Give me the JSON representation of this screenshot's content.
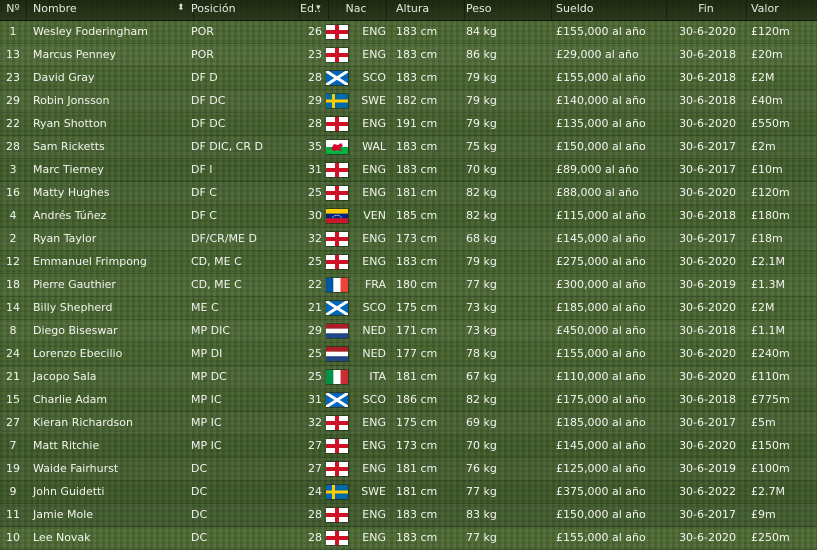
{
  "headers": {
    "no": "Nº",
    "name": "Nombre",
    "position": "Posición",
    "age": "Ed..",
    "nationality": "Nac",
    "height": "Altura",
    "weight": "Peso",
    "wage": "Sueldo",
    "contract_end": "Fin",
    "value": "Valor"
  },
  "sort_indicator_icon": "sort-updown-icon",
  "players": [
    {
      "no": "1",
      "name": "Wesley Foderingham",
      "position": "POR",
      "age": "26",
      "flag": "ENG",
      "nat": "ENG",
      "height": "183 cm",
      "weight": "84 kg",
      "wage": "£155,000 al año",
      "end": "30-6-2020",
      "value": "£120m"
    },
    {
      "no": "13",
      "name": "Marcus Penney",
      "position": "POR",
      "age": "23",
      "flag": "ENG",
      "nat": "ENG",
      "height": "183 cm",
      "weight": "86 kg",
      "wage": "£29,000 al año",
      "end": "30-6-2018",
      "value": "£20m"
    },
    {
      "no": "23",
      "name": "David Gray",
      "position": "DF D",
      "age": "28",
      "flag": "SCO",
      "nat": "SCO",
      "height": "183 cm",
      "weight": "79 kg",
      "wage": "£155,000 al año",
      "end": "30-6-2018",
      "value": "£2M"
    },
    {
      "no": "29",
      "name": "Robin Jonsson",
      "position": "DF DC",
      "age": "29",
      "flag": "SWE",
      "nat": "SWE",
      "height": "182 cm",
      "weight": "79 kg",
      "wage": "£140,000 al año",
      "end": "30-6-2018",
      "value": "£40m"
    },
    {
      "no": "22",
      "name": "Ryan Shotton",
      "position": "DF DC",
      "age": "28",
      "flag": "ENG",
      "nat": "ENG",
      "height": "191 cm",
      "weight": "79 kg",
      "wage": "£135,000 al año",
      "end": "30-6-2020",
      "value": "£550m"
    },
    {
      "no": "28",
      "name": "Sam Ricketts",
      "position": "DF DIC, CR D",
      "age": "35",
      "flag": "WAL",
      "nat": "WAL",
      "height": "183 cm",
      "weight": "75 kg",
      "wage": "£150,000 al año",
      "end": "30-6-2017",
      "value": "£2m"
    },
    {
      "no": "3",
      "name": "Marc Tierney",
      "position": "DF I",
      "age": "31",
      "flag": "ENG",
      "nat": "ENG",
      "height": "183 cm",
      "weight": "70 kg",
      "wage": "£89,000 al año",
      "end": "30-6-2017",
      "value": "£10m"
    },
    {
      "no": "16",
      "name": "Matty Hughes",
      "position": "DF C",
      "age": "25",
      "flag": "ENG",
      "nat": "ENG",
      "height": "181 cm",
      "weight": "82 kg",
      "wage": "£88,000 al año",
      "end": "30-6-2020",
      "value": "£120m"
    },
    {
      "no": "4",
      "name": "Andrés Túñez",
      "position": "DF C",
      "age": "30",
      "flag": "VEN",
      "nat": "VEN",
      "height": "185 cm",
      "weight": "82 kg",
      "wage": "£115,000 al año",
      "end": "30-6-2018",
      "value": "£180m"
    },
    {
      "no": "2",
      "name": "Ryan Taylor",
      "position": "DF/CR/ME D",
      "age": "32",
      "flag": "ENG",
      "nat": "ENG",
      "height": "173 cm",
      "weight": "68 kg",
      "wage": "£145,000 al año",
      "end": "30-6-2017",
      "value": "£18m"
    },
    {
      "no": "12",
      "name": "Emmanuel Frimpong",
      "position": "CD, ME C",
      "age": "25",
      "flag": "ENG",
      "nat": "ENG",
      "height": "183 cm",
      "weight": "79 kg",
      "wage": "£275,000 al año",
      "end": "30-6-2020",
      "value": "£2.1M"
    },
    {
      "no": "18",
      "name": "Pierre Gauthier",
      "position": "CD, ME C",
      "age": "22",
      "flag": "FRA",
      "nat": "FRA",
      "height": "180 cm",
      "weight": "77 kg",
      "wage": "£300,000 al año",
      "end": "30-6-2019",
      "value": "£1.3M"
    },
    {
      "no": "14",
      "name": "Billy Shepherd",
      "position": "ME C",
      "age": "21",
      "flag": "SCO",
      "nat": "SCO",
      "height": "175 cm",
      "weight": "73 kg",
      "wage": "£185,000 al año",
      "end": "30-6-2020",
      "value": "£2M"
    },
    {
      "no": "8",
      "name": "Diego Biseswar",
      "position": "MP DIC",
      "age": "29",
      "flag": "NED",
      "nat": "NED",
      "height": "171 cm",
      "weight": "73 kg",
      "wage": "£450,000 al año",
      "end": "30-6-2018",
      "value": "£1.1M"
    },
    {
      "no": "24",
      "name": "Lorenzo Ebecilio",
      "position": "MP DI",
      "age": "25",
      "flag": "NED",
      "nat": "NED",
      "height": "177 cm",
      "weight": "78 kg",
      "wage": "£155,000 al año",
      "end": "30-6-2020",
      "value": "£240m"
    },
    {
      "no": "21",
      "name": "Jacopo Sala",
      "position": "MP DC",
      "age": "25",
      "flag": "ITA",
      "nat": "ITA",
      "height": "181 cm",
      "weight": "67 kg",
      "wage": "£110,000 al año",
      "end": "30-6-2020",
      "value": "£110m"
    },
    {
      "no": "15",
      "name": "Charlie Adam",
      "position": "MP IC",
      "age": "31",
      "flag": "SCO",
      "nat": "SCO",
      "height": "186 cm",
      "weight": "82 kg",
      "wage": "£175,000 al año",
      "end": "30-6-2018",
      "value": "£775m"
    },
    {
      "no": "27",
      "name": "Kieran Richardson",
      "position": "MP IC",
      "age": "32",
      "flag": "ENG",
      "nat": "ENG",
      "height": "175 cm",
      "weight": "69 kg",
      "wage": "£185,000 al año",
      "end": "30-6-2017",
      "value": "£5m"
    },
    {
      "no": "7",
      "name": "Matt Ritchie",
      "position": "MP IC",
      "age": "27",
      "flag": "ENG",
      "nat": "ENG",
      "height": "173 cm",
      "weight": "70 kg",
      "wage": "£145,000 al año",
      "end": "30-6-2020",
      "value": "£150m"
    },
    {
      "no": "19",
      "name": "Waide Fairhurst",
      "position": "DC",
      "age": "27",
      "flag": "ENG",
      "nat": "ENG",
      "height": "181 cm",
      "weight": "76 kg",
      "wage": "£125,000 al año",
      "end": "30-6-2019",
      "value": "£100m"
    },
    {
      "no": "9",
      "name": "John Guidetti",
      "position": "DC",
      "age": "24",
      "flag": "SWE",
      "nat": "SWE",
      "height": "181 cm",
      "weight": "77 kg",
      "wage": "£375,000 al año",
      "end": "30-6-2022",
      "value": "£2.7M"
    },
    {
      "no": "11",
      "name": "Jamie Mole",
      "position": "DC",
      "age": "28",
      "flag": "ENG",
      "nat": "ENG",
      "height": "183 cm",
      "weight": "83 kg",
      "wage": "£150,000 al año",
      "end": "30-6-2017",
      "value": "£9m"
    },
    {
      "no": "10",
      "name": "Lee Novak",
      "position": "DC",
      "age": "28",
      "flag": "ENG",
      "nat": "ENG",
      "height": "183 cm",
      "weight": "77 kg",
      "wage": "£155,000 al año",
      "end": "30-6-2020",
      "value": "£250m"
    }
  ]
}
